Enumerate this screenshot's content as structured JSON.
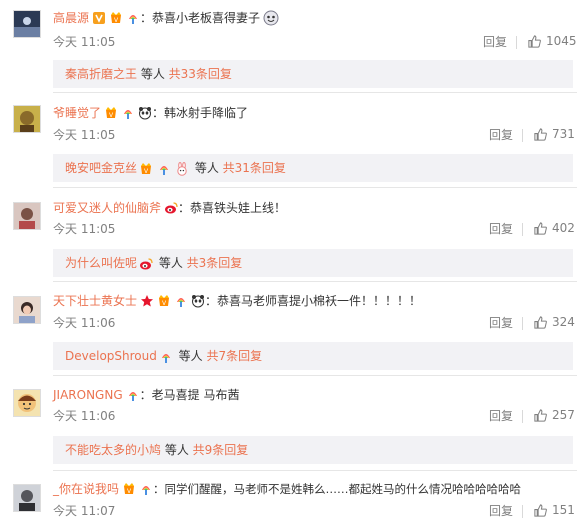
{
  "colors": {
    "link": "#eb7350",
    "meta": "#808080",
    "subbox_bg": "#f2f2f5"
  },
  "comments": [
    {
      "username": "高晨源",
      "badges": [
        "v-badge-icon",
        "vip-badge-icon",
        "rainbow-badge-icon"
      ],
      "text": "：恭喜小老板喜得妻子",
      "emoji": "laughing-cry-emoji",
      "time": "今天 11:05",
      "reply_label": "回复",
      "likes": "1045",
      "subreply": {
        "name": "秦高折磨之王",
        "mid": " 等人 ",
        "count": "共33条回复"
      }
    },
    {
      "username": "爷睡觉了",
      "badges": [
        "vip-badge-icon",
        "rainbow-badge-icon",
        "panda-badge-icon"
      ],
      "text": "：韩冰射手降临了",
      "time": "今天 11:05",
      "reply_label": "回复",
      "likes": "731",
      "subreply": {
        "name": "晚安吧金克丝",
        "badges": [
          "vip-badge-icon",
          "rainbow-badge-icon",
          "bunny-badge-icon"
        ],
        "mid": " 等人 ",
        "count": "共31条回复"
      }
    },
    {
      "username": "可爱又迷人的仙脑斧",
      "badges": [
        "weibo-badge-icon"
      ],
      "text": "：恭喜铁头娃上线！",
      "time": "今天 11:05",
      "reply_label": "回复",
      "likes": "402",
      "subreply": {
        "name": "为什么叫佐呢",
        "badges": [
          "weibo-badge-icon"
        ],
        "mid": " 等人 ",
        "count": "共3条回复"
      }
    },
    {
      "username": "天下壮士黄女士",
      "badges": [
        "star-badge-icon",
        "vip-badge-icon",
        "rainbow-badge-icon",
        "panda-badge-icon"
      ],
      "text": "：恭喜马老师喜提小棉袄一件！！！！！",
      "time": "今天 11:06",
      "reply_label": "回复",
      "likes": "324",
      "subreply": {
        "name": "DevelopShroud",
        "badges": [
          "rainbow-badge-icon"
        ],
        "mid": " 等人 ",
        "count": "共7条回复"
      }
    },
    {
      "username": "JIARONGNG",
      "badges": [
        "rainbow-badge-icon"
      ],
      "text": "：老马喜提 马布茜",
      "time": "今天 11:06",
      "reply_label": "回复",
      "likes": "257",
      "subreply": {
        "name": "不能吃太多的小鸠",
        "mid": " 等人 ",
        "count": "共9条回复"
      }
    },
    {
      "username": "_你在说我吗",
      "badges": [
        "vip-badge-icon",
        "rainbow-badge-icon"
      ],
      "text": "：同学们醒醒，马老师不是姓韩么……都起姓马的什么情况哈哈哈哈哈哈",
      "time": "今天 11:07",
      "reply_label": "回复",
      "likes": "151"
    }
  ]
}
